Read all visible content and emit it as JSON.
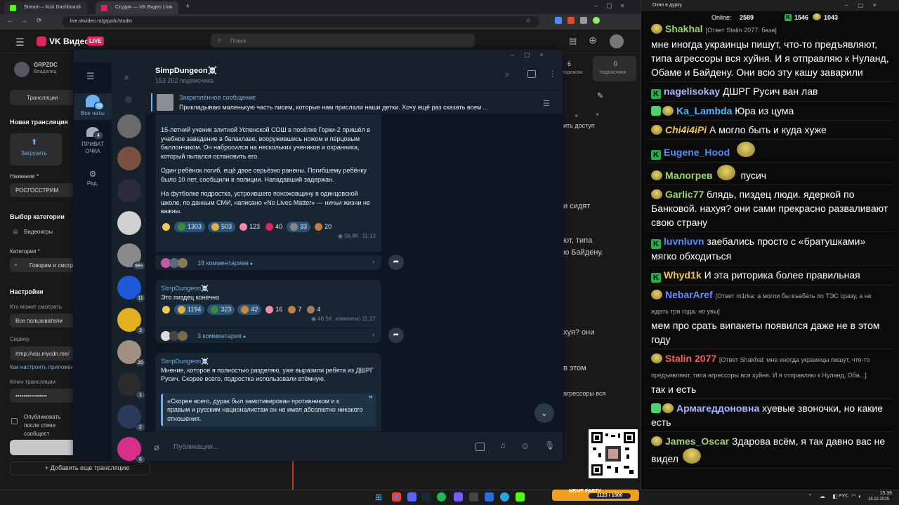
{
  "browser": {
    "tabs": [
      {
        "label": "Stream – Kick Dashboard",
        "color": "#53fc18"
      },
      {
        "label": "Студия — VK Видео Live",
        "color": "#e0245e"
      }
    ],
    "new_tab": "+",
    "url": "live.vkvideo.ru/grpzdc/studio"
  },
  "vk": {
    "logo": "VK Видео",
    "live_badge": "LIVE",
    "search_placeholder": "Поиск",
    "channel": "GRPZDC",
    "channel_role": "Владелец",
    "nav_tab": "Трансляции",
    "new_stream_title": "Новая трансляция",
    "upload_label": "Загрузить",
    "name_label": "Название *",
    "name_value": "РОСГОССТРИМ",
    "category_section": "Выбор категории",
    "category_option": "Видеоигры",
    "category_label": "Категория *",
    "category_value": "Говорим и смотрим",
    "settings_label": "Настройки",
    "who_can_watch_label": "Кто может смотреть",
    "who_can_watch_value": "Все пользователи",
    "server_label": "Сервер",
    "server_value": "rtmp://vsu.mycdn.me/",
    "how_to_setup": "Как настроить приложение",
    "stream_key_label": "Ключ трансляции",
    "stream_key_value": "••••••••••••••••",
    "publish_checkbox_label": "Опубликовать после стене сообщест",
    "add_stream_button": "Добавить еще трансляцию",
    "right_stats": [
      {
        "value": "6",
        "label": "подписки"
      },
      {
        "value": "0",
        "label": "подписчики"
      }
    ],
    "peek_texts": [
      "ить доступ",
      "и сидят",
      "ют, типа",
      "ю Байдену.",
      "хуя? они",
      "в этом",
      "агрессоры вся"
    ]
  },
  "telegram": {
    "folders": [
      {
        "label": "Все чаты",
        "badge": "18"
      },
      {
        "label": "ПРИВАТ ОЧКА",
        "badge": "4"
      },
      {
        "label": "Ред.",
        "badge": ""
      }
    ],
    "chat_badges": [
      "",
      "",
      "",
      "",
      "",
      "99+",
      "11",
      "3",
      "20",
      "1",
      "2",
      "6"
    ],
    "channel_name": "SimpDungeon☠️",
    "subscribers": "153 202 подписчика",
    "pinned_title": "Закреплённое сообщение",
    "pinned_text": "Прикладываю маленькую часть писем, которые нам прислали наши детки.   Хочу ещё раз сказать всем ...",
    "posts": [
      {
        "paragraphs": [
          "15-летний ученик элитной Успенской СОШ в посёлке Горки-2 пришёл в учебное заведение в балаклаве, вооружившись ножом и перцовым баллончиком. Он набросился на нескольких учеников и охранника, который пытался остановить его.",
          "Один ребёнок погиб, ещё двое серьёзно ранены. Погибшему ребёнку было 10 лет, сообщили в полиции. Нападавший задержан.",
          "На футболке подростка, устроившего поножовщину в одинцовской школе, по данным СМИ, написано «No Lives Matter» — ничьи жизни не важны."
        ],
        "reactions": [
          {
            "icon": "star",
            "count": ""
          },
          {
            "icon": "frog",
            "count": "1303"
          },
          {
            "icon": "cry",
            "count": "503"
          },
          {
            "icon": "pig",
            "count": "123"
          },
          {
            "icon": "heart",
            "count": "40"
          },
          {
            "icon": "sticker",
            "count": "33"
          },
          {
            "icon": "dude",
            "count": "20"
          }
        ],
        "views": "56.8K",
        "time": "11:13",
        "comments": "18 комментариев"
      },
      {
        "author": "SimpDungeon☠️",
        "text": "Это пиздец конечно",
        "reactions": [
          {
            "icon": "star",
            "count": ""
          },
          {
            "icon": "cry",
            "count": "1194"
          },
          {
            "icon": "frog",
            "count": "323"
          },
          {
            "icon": "burger",
            "count": "42"
          },
          {
            "icon": "pig",
            "count": "16"
          },
          {
            "icon": "dude",
            "count": "7"
          },
          {
            "icon": "cat",
            "count": "4"
          }
        ],
        "views": "46.5K",
        "time": "изменено 11:27",
        "comments": "3 комментария"
      },
      {
        "author": "SimpDungeon☠️",
        "text": "Мнение, которое я полностью разделяю, уже выразили ребята из ДШРГ Русич. Скорее всего, подростка использовали втёмную.",
        "quote": "«Скорее всего, дурак был замотивирован противником и к правым и русским националистам он не имел абсолютно никакого отношения."
      }
    ],
    "input_placeholder": "Публикация..."
  },
  "chat": {
    "window_title": "Окно в дурку",
    "online_label": "Online:",
    "online_value": "2589",
    "kick_count": "1546",
    "other_count": "1043",
    "messages": [
      {
        "user": "Shakhal",
        "color": "#9bd36b",
        "badge": "emo",
        "reply": "[Ответ Stalin 2077: база]",
        "text": "мне иногда украинцы пишут, что-то предъявляют, типа агрессоры вся хуйня. И я отправляю к Нуланд, Обаме и Байдену. Они всю эту кашу заварили"
      },
      {
        "user": "nagelisokay",
        "color": "#a8b4ff",
        "badge": "kick",
        "reply": "",
        "text": "ДШРГ Русич ван лав"
      },
      {
        "user": "Ka_Lambda",
        "color": "#4fb7ff",
        "badge": "sub+emo",
        "reply": "",
        "text": "Юра из цума"
      },
      {
        "user": "Chi4i4iPi",
        "color": "#f2c94c",
        "badge": "emo",
        "reply": "",
        "text": "А могло быть и куда хуже",
        "italic": true
      },
      {
        "user": "Eugene_Hood",
        "color": "#4f8cff",
        "badge": "kick",
        "reply": "",
        "text": "",
        "emote_after": true
      },
      {
        "user": "Малогрев",
        "color": "#9bd36b",
        "badge": "emo",
        "reply": "",
        "text": "пусич",
        "emote_before": true
      },
      {
        "user": "Garlic77",
        "color": "#9bd36b",
        "badge": "emo",
        "reply": "",
        "text": "блядь, пиздец люди. ядеркой по Банковой. нахуя? они сами прекрасно разваливают свою страну"
      },
      {
        "user": "luvnluvn",
        "color": "#4f8cff",
        "badge": "kick",
        "reply": "",
        "text": "заебались просто с «братушками» мягко обходиться"
      },
      {
        "user": "Whyd1k",
        "color": "#f2c94c",
        "badge": "kick",
        "reply": "",
        "text": "И эта риторика более правильная"
      },
      {
        "user": "NebarAref",
        "color": "#6a8cff",
        "badge": "emo",
        "reply": "[Ответ m1rka: а могли бы въебать по ТЭС сразу, а не ждать три года. но увы]",
        "text": "мем про срать випакеты появился даже не в этом году"
      },
      {
        "user": "Stalin 2077",
        "color": "#ff5a5a",
        "badge": "emo",
        "reply": "[Ответ Shakhal: мне иногда украинцы пишут, что-то предъявляют, типа агрессоры вся хуйня. И я отправляю к Нуланд, Оба...]",
        "text": "так и есть"
      },
      {
        "user": "Армагеддоновна",
        "color": "#a8b4ff",
        "badge": "sub+emo",
        "reply": "",
        "text": "хуевые звоночки, но какие есть"
      },
      {
        "user": "James_Oscar",
        "color": "#9bd36b",
        "badge": "emo",
        "reply": "",
        "text": "Здарова всём, я так давно вас не видел",
        "emote_after": true
      }
    ]
  },
  "overlay": {
    "widget_label": "MEME PARTY",
    "widget_value": "1123 / 1500"
  },
  "taskbar": {
    "lang": "РУС",
    "time": "15:36",
    "date": "16.12.2025"
  },
  "icons": [
    "menu-icon",
    "search-icon",
    "columns-icon",
    "more-icon",
    "pin-icon",
    "attach-icon",
    "calendar-icon",
    "bell-icon",
    "emoji-icon",
    "mic-icon",
    "share-icon",
    "chevron-right-icon",
    "chevron-down-icon",
    "settings-icon",
    "close-icon",
    "windows-start-icon",
    "qr-code"
  ]
}
